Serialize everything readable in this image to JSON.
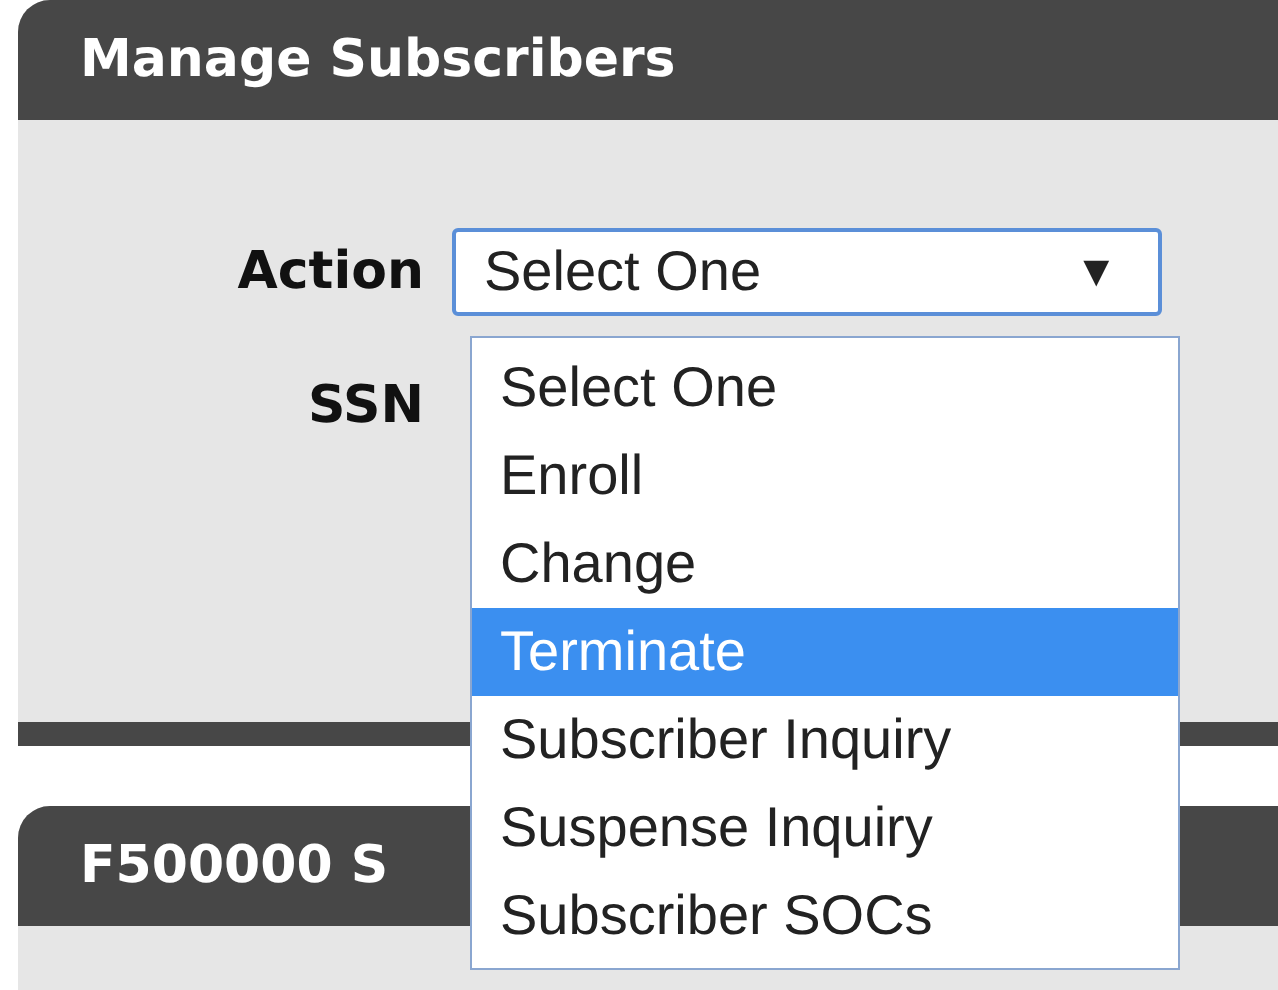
{
  "panels": [
    {
      "title": "Manage Subscribers",
      "fields": [
        {
          "label": "Action",
          "kind": "select",
          "value": "Select One",
          "arrow": "▼"
        },
        {
          "label": "SSN",
          "kind": "text"
        }
      ]
    },
    {
      "title": "F500000 S"
    }
  ],
  "dropdown": {
    "options": [
      {
        "label": "Select One",
        "selected": false
      },
      {
        "label": "Enroll",
        "selected": false
      },
      {
        "label": "Change",
        "selected": false
      },
      {
        "label": "Terminate",
        "selected": true
      },
      {
        "label": "Subscriber Inquiry",
        "selected": false
      },
      {
        "label": "Suspense Inquiry",
        "selected": false
      },
      {
        "label": "Subscriber SOCs",
        "selected": false
      }
    ]
  }
}
